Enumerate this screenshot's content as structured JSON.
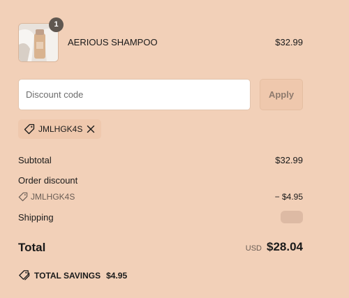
{
  "product": {
    "name": "AERIOUS SHAMPOO",
    "price": "$32.99",
    "quantity": "1"
  },
  "discount": {
    "placeholder": "Discount code",
    "value": "",
    "apply_label": "Apply",
    "applied_code": "JMLHGK4S"
  },
  "summary": {
    "subtotal_label": "Subtotal",
    "subtotal_value": "$32.99",
    "order_discount_label": "Order discount",
    "discount_code": "JMLHGK4S",
    "discount_amount": "− $4.95",
    "shipping_label": "Shipping",
    "total_label": "Total",
    "total_currency": "USD",
    "total_amount": "$28.04",
    "savings_label": "TOTAL SAVINGS",
    "savings_amount": "$4.95"
  },
  "colors": {
    "background": "#f2d0b8",
    "badge": "#5f5750",
    "apply_button": "#efc8ad"
  }
}
